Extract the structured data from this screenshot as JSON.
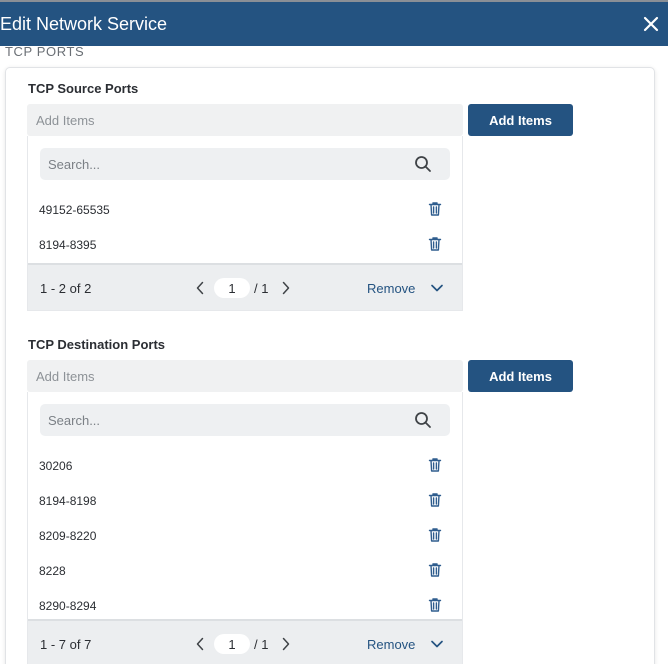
{
  "window": {
    "title": "Edit Network Service"
  },
  "section_title": "TCP PORTS",
  "source": {
    "label": "TCP Source Ports",
    "add_placeholder": "Add Items",
    "add_button": "Add Items",
    "search_placeholder": "Search...",
    "items": [
      "49152-65535",
      "8194-8395"
    ],
    "range": "1 - 2 of 2",
    "page": "1",
    "total_pages": "/ 1",
    "remove": "Remove"
  },
  "destination": {
    "label": "TCP Destination Ports",
    "add_placeholder": "Add Items",
    "add_button": "Add Items",
    "search_placeholder": "Search...",
    "items": [
      "30206",
      "8194-8198",
      "8209-8220",
      "8228",
      "8290-8294"
    ],
    "range": "1 - 7 of 7",
    "page": "1",
    "total_pages": "/ 1",
    "remove": "Remove"
  },
  "colors": {
    "accent": "#245381",
    "panel_bg": "#f0f1f2"
  },
  "icons": [
    "close-icon",
    "search-icon",
    "trash-icon",
    "chevron-left-icon",
    "chevron-right-icon",
    "chevron-down-icon"
  ]
}
